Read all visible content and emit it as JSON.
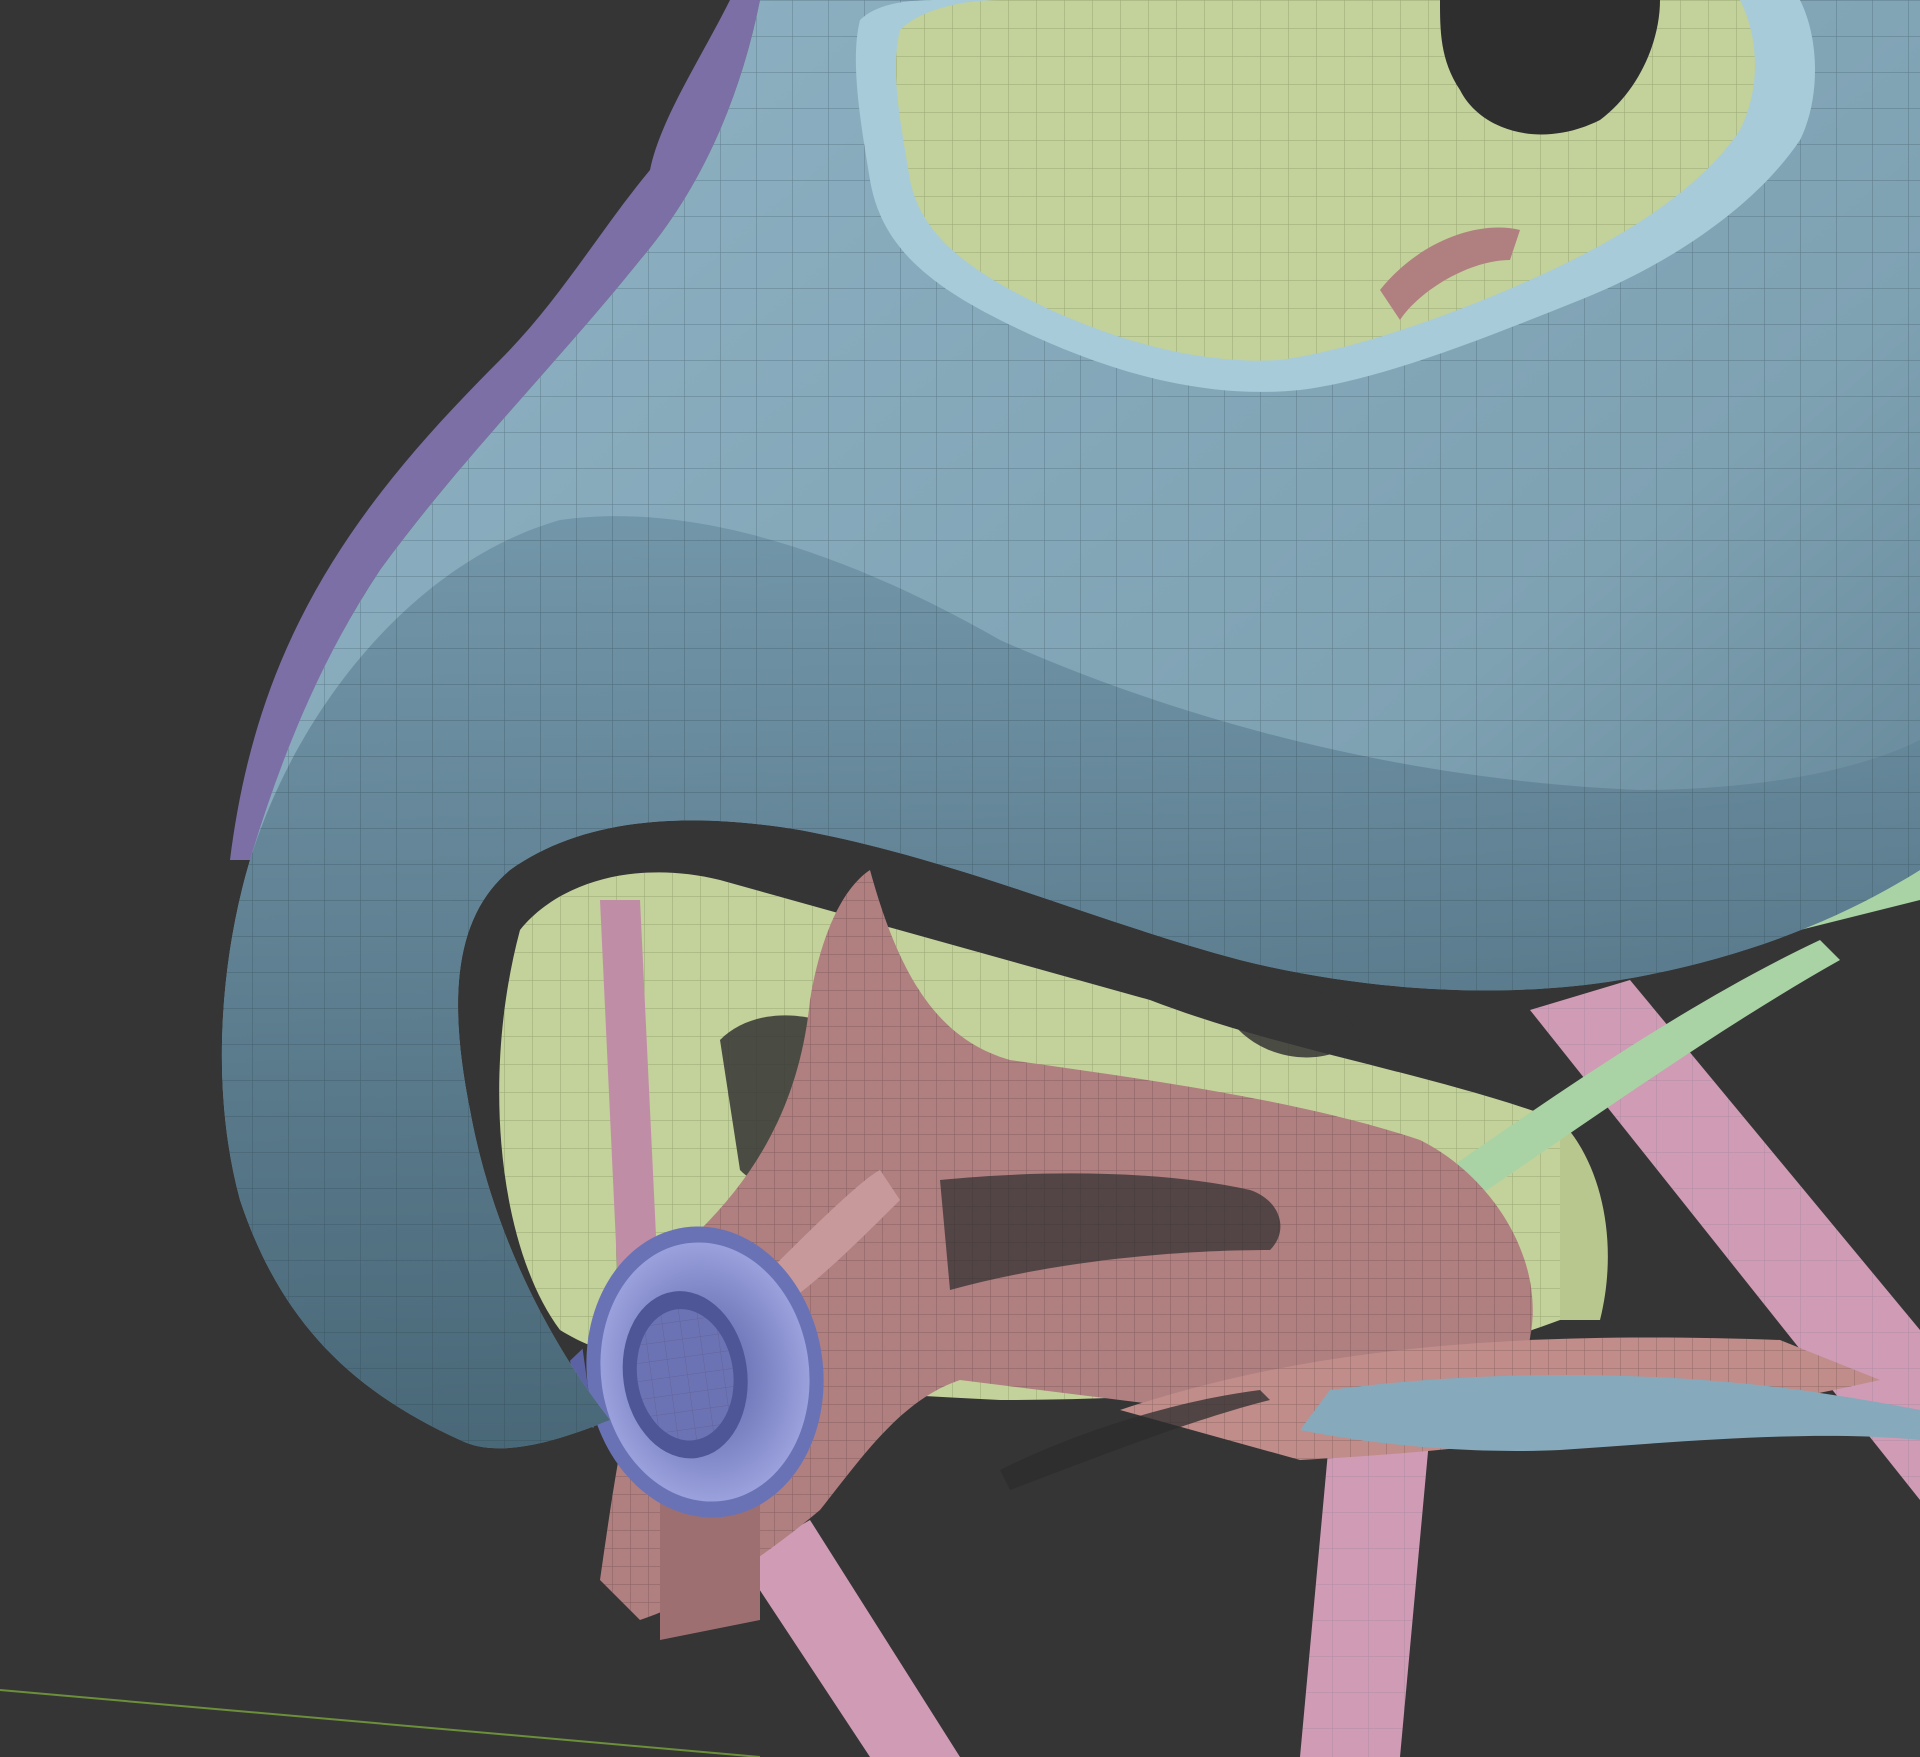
{
  "viewport": {
    "background_color": "#353535",
    "grid_line_color": "#6b8f3a"
  },
  "model": {
    "wireframe_color": "#2f4652",
    "parts": [
      {
        "name": "outer-shell",
        "color": "#86aabb"
      },
      {
        "name": "shell-rim",
        "color": "#7c6fa6"
      },
      {
        "name": "inner-padding",
        "color": "#c3d19a"
      },
      {
        "name": "cradle-frame",
        "color": "#b07f80"
      },
      {
        "name": "strap",
        "color": "#cf9bb5"
      },
      {
        "name": "adjuster-band",
        "color": "#a9d3a4"
      },
      {
        "name": "dial-knob",
        "color": "#7f86c6"
      }
    ]
  }
}
